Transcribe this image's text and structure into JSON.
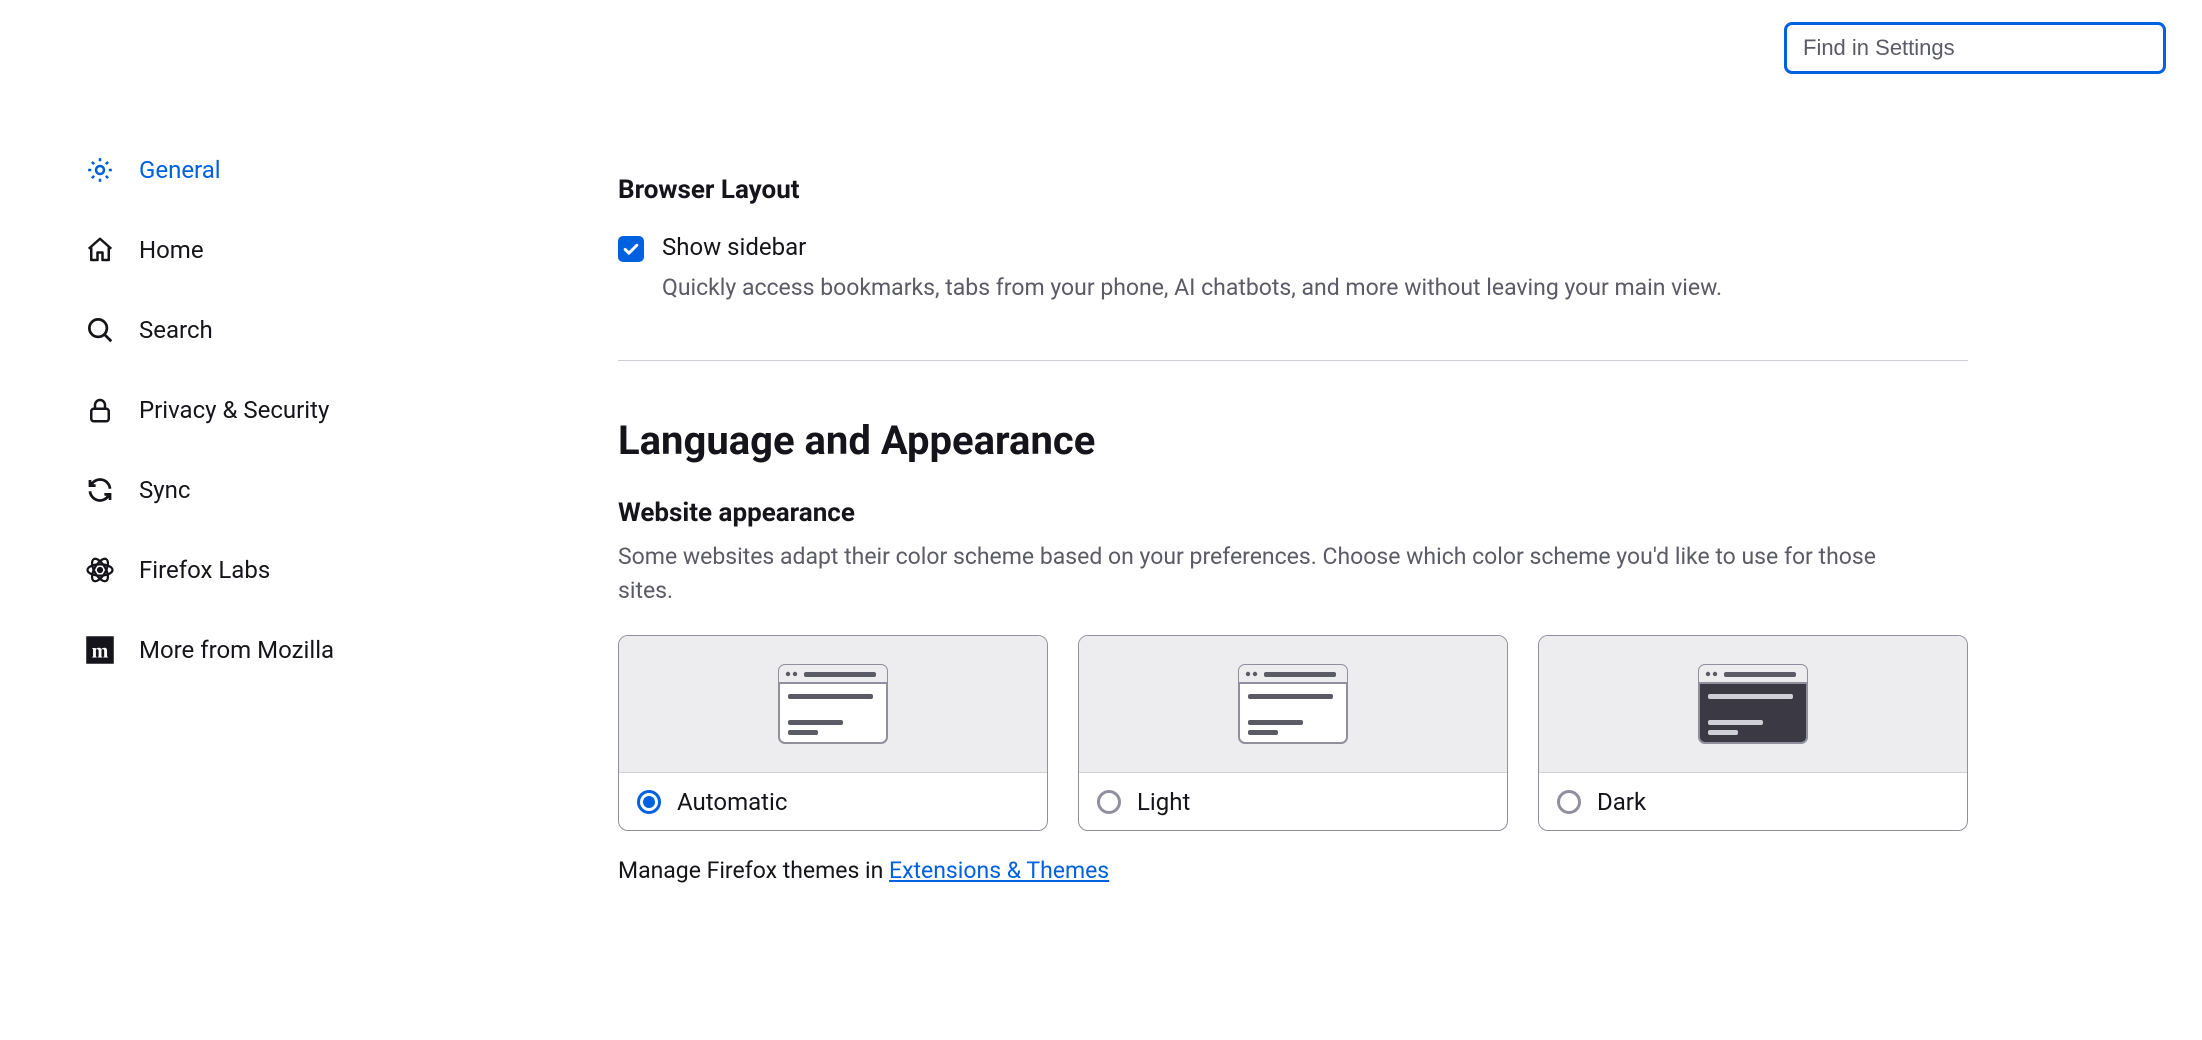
{
  "search": {
    "placeholder": "Find in Settings"
  },
  "sidebar": {
    "items": [
      {
        "label": "General"
      },
      {
        "label": "Home"
      },
      {
        "label": "Search"
      },
      {
        "label": "Privacy & Security"
      },
      {
        "label": "Sync"
      },
      {
        "label": "Firefox Labs"
      },
      {
        "label": "More from Mozilla"
      }
    ]
  },
  "browser_layout": {
    "heading": "Browser Layout",
    "checkbox_label": "Show sidebar",
    "checkbox_desc": "Quickly access bookmarks, tabs from your phone, AI chatbots, and more without leaving your main view."
  },
  "lang_appearance": {
    "heading": "Language and Appearance",
    "sub_heading": "Website appearance",
    "desc": "Some websites adapt their color scheme based on your preferences. Choose which color scheme you'd like to use for those sites.",
    "options": [
      {
        "label": "Automatic"
      },
      {
        "label": "Light"
      },
      {
        "label": "Dark"
      }
    ],
    "themes_prefix": "Manage Firefox themes in ",
    "themes_link": "Extensions & Themes"
  }
}
